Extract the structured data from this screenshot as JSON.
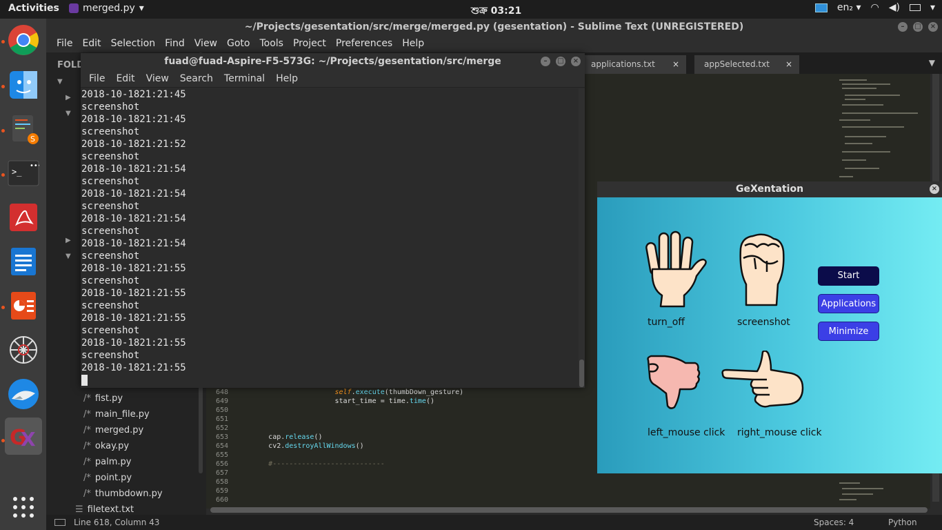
{
  "topbar": {
    "activities": "Activities",
    "app_menu": "merged.py",
    "clock": "শুক্র 03:21",
    "keyboard": "en₂"
  },
  "sublime": {
    "title": "~/Projects/gesentation/src/merge/merged.py (gesentation) - Sublime Text (UNREGISTERED)",
    "menu": [
      "File",
      "Edit",
      "Selection",
      "Find",
      "View",
      "Goto",
      "Tools",
      "Project",
      "Preferences",
      "Help"
    ],
    "sidebar_heading": "FOLD",
    "files": [
      {
        "glyph": "/*",
        "name": "fist.py"
      },
      {
        "glyph": "/*",
        "name": "main_file.py"
      },
      {
        "glyph": "/*",
        "name": "merged.py"
      },
      {
        "glyph": "/*",
        "name": "okay.py"
      },
      {
        "glyph": "/*",
        "name": "palm.py"
      },
      {
        "glyph": "/*",
        "name": "point.py"
      },
      {
        "glyph": "/*",
        "name": "thumbdown.py"
      },
      {
        "glyph": "☰",
        "name": "filetext.txt"
      }
    ],
    "tabs": [
      {
        "label": "applications.txt",
        "close": "×"
      },
      {
        "label": "appSelected.txt",
        "close": "×"
      }
    ],
    "code": [
      {
        "ln": "648",
        "indent": "                        ",
        "parts": [
          {
            "t": "self",
            "c": "kw-self"
          },
          {
            "t": ".",
            "c": ""
          },
          {
            "t": "execute",
            "c": "fn"
          },
          {
            "t": "(thumbDown_gesture)",
            "c": ""
          }
        ]
      },
      {
        "ln": "649",
        "indent": "                        ",
        "parts": [
          {
            "t": "start_time = time.",
            "c": ""
          },
          {
            "t": "time",
            "c": "fn"
          },
          {
            "t": "()",
            "c": ""
          }
        ]
      },
      {
        "ln": "650",
        "indent": "",
        "parts": []
      },
      {
        "ln": "651",
        "indent": "",
        "parts": []
      },
      {
        "ln": "652",
        "indent": "",
        "parts": []
      },
      {
        "ln": "653",
        "indent": "        ",
        "parts": [
          {
            "t": "cap.",
            "c": ""
          },
          {
            "t": "release",
            "c": "fn"
          },
          {
            "t": "()",
            "c": ""
          }
        ]
      },
      {
        "ln": "654",
        "indent": "        ",
        "parts": [
          {
            "t": "cv2.",
            "c": ""
          },
          {
            "t": "destroyAllWindows",
            "c": "fn"
          },
          {
            "t": "()",
            "c": ""
          }
        ]
      },
      {
        "ln": "655",
        "indent": "",
        "parts": []
      },
      {
        "ln": "656",
        "indent": "        ",
        "parts": [
          {
            "t": "#---------------------------",
            "c": "cmt"
          }
        ]
      },
      {
        "ln": "657",
        "indent": "",
        "parts": []
      },
      {
        "ln": "658",
        "indent": "",
        "parts": []
      },
      {
        "ln": "659",
        "indent": "",
        "parts": []
      },
      {
        "ln": "660",
        "indent": "",
        "parts": []
      }
    ],
    "status_position": "Line 618, Column 43",
    "status_spaces": "Spaces: 4",
    "status_syntax": "Python"
  },
  "terminal": {
    "title": "fuad@fuad-Aspire-F5-573G: ~/Projects/gesentation/src/merge",
    "menu": [
      "File",
      "Edit",
      "View",
      "Search",
      "Terminal",
      "Help"
    ],
    "lines": [
      "2018-10-1821:21:45",
      "screenshot",
      "2018-10-1821:21:45",
      "screenshot",
      "2018-10-1821:21:52",
      "screenshot",
      "2018-10-1821:21:54",
      "screenshot",
      "2018-10-1821:21:54",
      "screenshot",
      "2018-10-1821:21:54",
      "screenshot",
      "2018-10-1821:21:54",
      "screenshot",
      "2018-10-1821:21:55",
      "screenshot",
      "2018-10-1821:21:55",
      "screenshot",
      "2018-10-1821:21:55",
      "screenshot",
      "2018-10-1821:21:55",
      "screenshot",
      "2018-10-1821:21:55"
    ]
  },
  "gex": {
    "title": "GeXentation",
    "labels": {
      "open_palm": "turn_off",
      "fist": "screenshot",
      "thumb_down": "left_mouse click",
      "point": "right_mouse click"
    },
    "buttons": {
      "start": "Start",
      "applications": "Applications",
      "minimize": "Minimize"
    }
  }
}
